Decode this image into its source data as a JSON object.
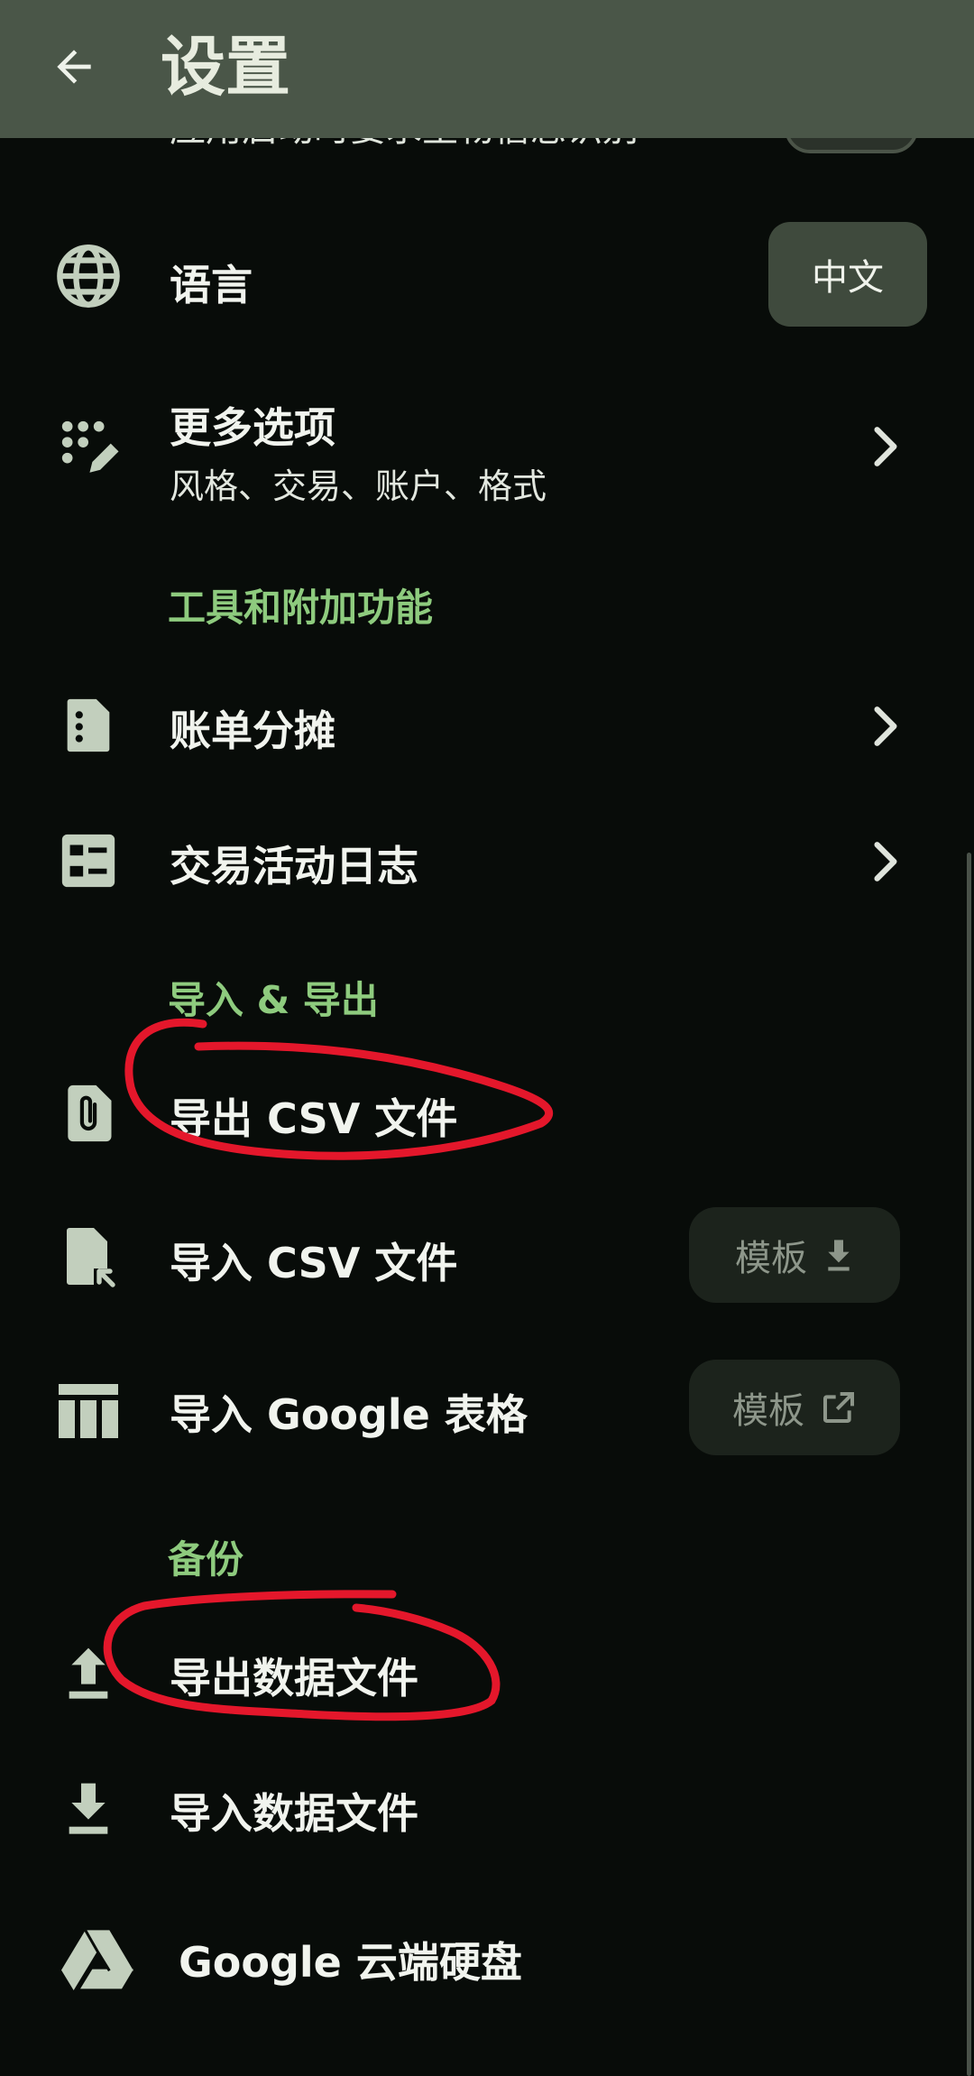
{
  "header": {
    "title": "设置",
    "back_icon": "arrow-left-icon"
  },
  "cutoff_row": {
    "text": "应用启动时要求生物信息识别"
  },
  "rows": {
    "language": {
      "title": "语言",
      "value": "中文",
      "icon": "globe-icon"
    },
    "more_options": {
      "title": "更多选项",
      "subtitle": "风格、交易、账户、格式",
      "icon": "dots-pen-icon"
    },
    "split_bill": {
      "title": "账单分摊",
      "icon": "file-dots-icon"
    },
    "activity_log": {
      "title": "交易活动日志",
      "icon": "checklist-icon"
    },
    "export_csv": {
      "title": "导出 CSV 文件",
      "icon": "file-clip-icon"
    },
    "import_csv": {
      "title": "导入 CSV 文件",
      "template_label": "模板",
      "icon": "file-import-icon"
    },
    "import_sheets": {
      "title": "导入 Google 表格",
      "template_label": "模板",
      "icon": "table-icon"
    },
    "export_data": {
      "title": "导出数据文件",
      "icon": "upload-icon"
    },
    "import_data": {
      "title": "导入数据文件",
      "icon": "download-icon"
    },
    "google_drive": {
      "title": "Google 云端硬盘",
      "icon": "google-drive-icon"
    }
  },
  "sections": {
    "tools": "工具和附加功能",
    "import_export": "导入 & 导出",
    "backup": "备份"
  },
  "colors": {
    "header_bg": "#4a5648",
    "background": "#080c09",
    "section_accent": "#8ecb7e",
    "icon_tint": "#c2cfbd",
    "annotation_red": "#e4172b"
  }
}
